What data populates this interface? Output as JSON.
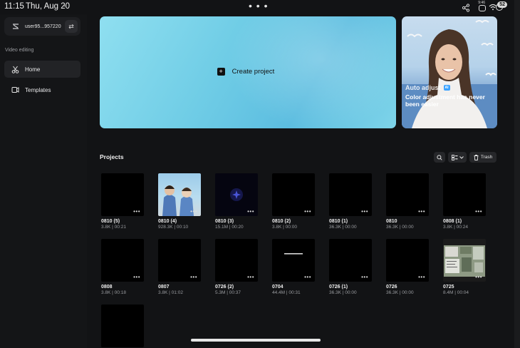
{
  "status_bar": {
    "time": "11:15",
    "date": "Thu, Aug 20",
    "extra": "•••",
    "mini_time": "9:46",
    "battery": "52"
  },
  "sidebar": {
    "username": "user95...957220",
    "section_label": "Video editing",
    "nav": [
      {
        "label": "Home",
        "icon": "home-scissors-icon",
        "active": true
      },
      {
        "label": "Templates",
        "icon": "templates-icon",
        "active": false
      }
    ]
  },
  "hero": {
    "create_label": "Create project",
    "promo_title": "Auto adjust",
    "promo_badge": "AI",
    "promo_subtitle": "Color adjustment has never been easier"
  },
  "projects": {
    "title": "Projects",
    "trash_label": "Trash",
    "items": [
      {
        "name": "0810 (5)",
        "meta": "3.8K | 00:21",
        "thumb": "black"
      },
      {
        "name": "0810 (4)",
        "meta": "928.3K | 00:10",
        "thumb": "photo-people"
      },
      {
        "name": "0810 (3)",
        "meta": "15.1M | 00:20",
        "thumb": "dark-glow"
      },
      {
        "name": "0810 (2)",
        "meta": "3.8K | 00:00",
        "thumb": "black"
      },
      {
        "name": "0810 (1)",
        "meta": "36.3K | 00:00",
        "thumb": "black"
      },
      {
        "name": "0810",
        "meta": "36.3K | 00:00",
        "thumb": "black"
      },
      {
        "name": "0808 (1)",
        "meta": "3.8K | 00:24",
        "thumb": "black"
      },
      {
        "name": "0808",
        "meta": "3.8K | 00:18",
        "thumb": "black"
      },
      {
        "name": "0807",
        "meta": "3.8K | 01:02",
        "thumb": "black"
      },
      {
        "name": "0726 (2)",
        "meta": "5.3M | 00:37",
        "thumb": "black"
      },
      {
        "name": "0704",
        "meta": "44.4M | 00:31",
        "thumb": "text-line"
      },
      {
        "name": "0726 (1)",
        "meta": "36.3K | 00:00",
        "thumb": "black"
      },
      {
        "name": "0726",
        "meta": "36.3K | 00:00",
        "thumb": "black"
      },
      {
        "name": "0725",
        "meta": "8.4M | 00:04",
        "thumb": "screenshot"
      },
      {
        "name": "",
        "meta": "",
        "thumb": "black"
      }
    ]
  }
}
